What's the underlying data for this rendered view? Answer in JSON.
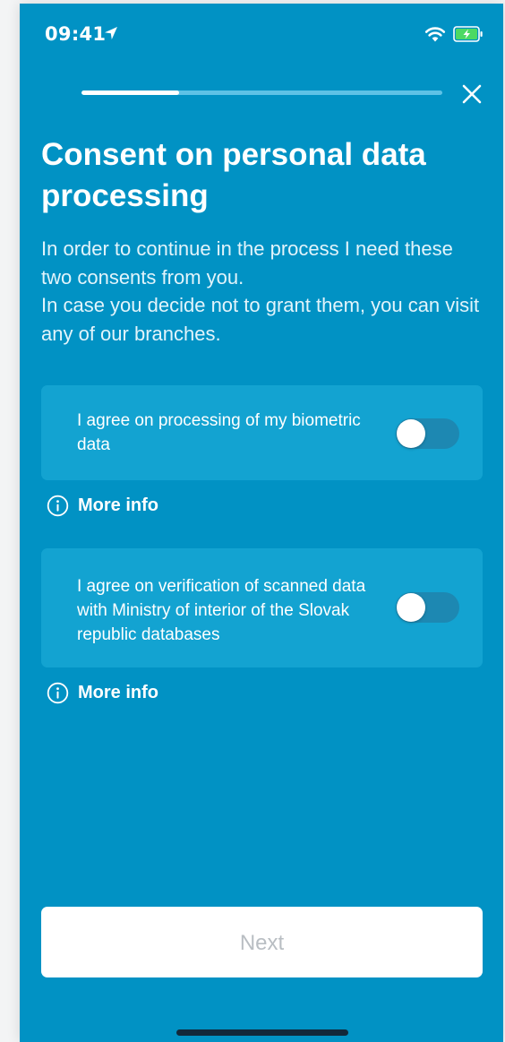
{
  "status_bar": {
    "time": "09:41",
    "icons": [
      "location-arrow-icon",
      "wifi-icon",
      "battery-charging-icon"
    ]
  },
  "progress": {
    "fraction": 0.27
  },
  "title": "Consent on personal data processing",
  "intro": {
    "line1": "In order to continue in the process I need these two consents from you.",
    "line2": "In case you decide not to grant them, you can visit any of our branches."
  },
  "consents": [
    {
      "label": "I agree on processing of my biometric data",
      "enabled": false,
      "more_info": "More info"
    },
    {
      "label": "I agree on verification of scanned data with Ministry of interior of the Slovak republic databases",
      "enabled": false,
      "more_info": "More info"
    }
  ],
  "next_button": {
    "label": "Next",
    "disabled": true
  },
  "colors": {
    "background": "#0192c4",
    "card": "#13a3d1",
    "toggle_off": "#1d88b2",
    "battery_green": "#4cd964",
    "disabled_text": "#b9bec3"
  }
}
